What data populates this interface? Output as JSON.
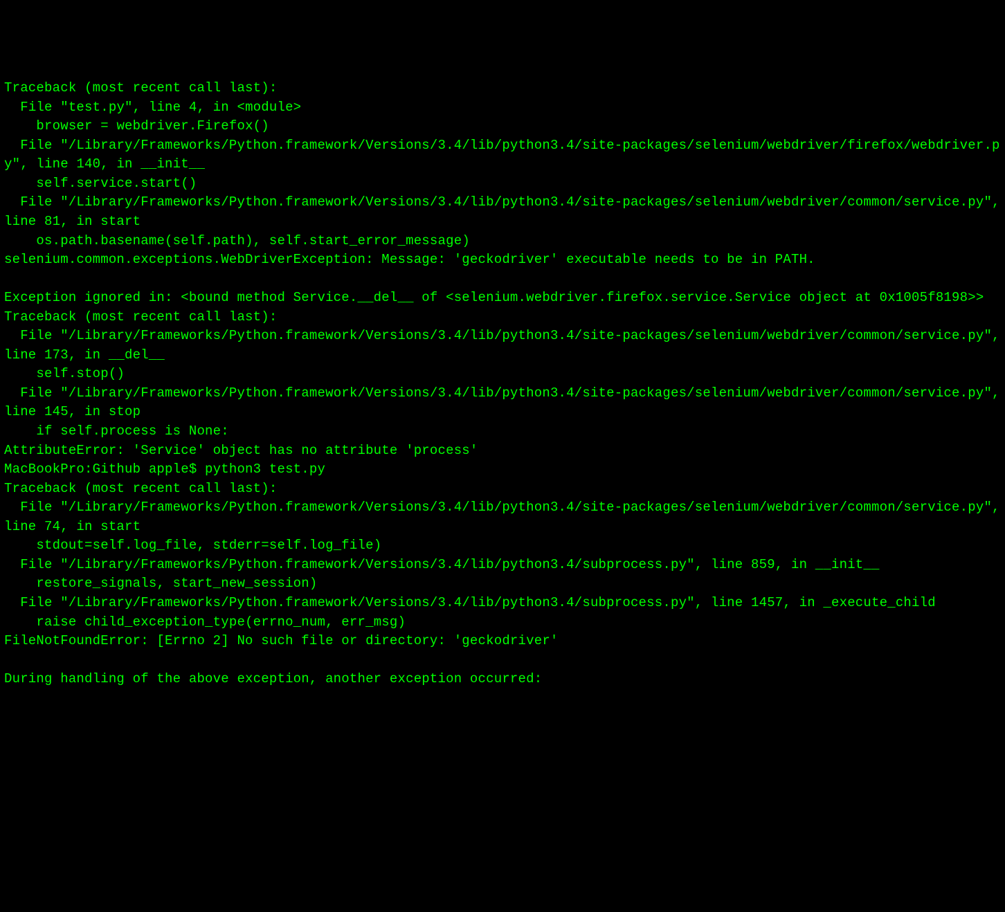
{
  "terminal": {
    "lines": [
      "Traceback (most recent call last):",
      "  File \"test.py\", line 4, in <module>",
      "    browser = webdriver.Firefox()",
      "  File \"/Library/Frameworks/Python.framework/Versions/3.4/lib/python3.4/site-packages/selenium/webdriver/firefox/webdriver.py\", line 140, in __init__",
      "    self.service.start()",
      "  File \"/Library/Frameworks/Python.framework/Versions/3.4/lib/python3.4/site-packages/selenium/webdriver/common/service.py\", line 81, in start",
      "    os.path.basename(self.path), self.start_error_message)",
      "selenium.common.exceptions.WebDriverException: Message: 'geckodriver' executable needs to be in PATH. ",
      "",
      "Exception ignored in: <bound method Service.__del__ of <selenium.webdriver.firefox.service.Service object at 0x1005f8198>>",
      "Traceback (most recent call last):",
      "  File \"/Library/Frameworks/Python.framework/Versions/3.4/lib/python3.4/site-packages/selenium/webdriver/common/service.py\", line 173, in __del__",
      "    self.stop()",
      "  File \"/Library/Frameworks/Python.framework/Versions/3.4/lib/python3.4/site-packages/selenium/webdriver/common/service.py\", line 145, in stop",
      "    if self.process is None:",
      "AttributeError: 'Service' object has no attribute 'process'",
      "MacBookPro:Github apple$ python3 test.py",
      "Traceback (most recent call last):",
      "  File \"/Library/Frameworks/Python.framework/Versions/3.4/lib/python3.4/site-packages/selenium/webdriver/common/service.py\", line 74, in start",
      "    stdout=self.log_file, stderr=self.log_file)",
      "  File \"/Library/Frameworks/Python.framework/Versions/3.4/lib/python3.4/subprocess.py\", line 859, in __init__",
      "    restore_signals, start_new_session)",
      "  File \"/Library/Frameworks/Python.framework/Versions/3.4/lib/python3.4/subprocess.py\", line 1457, in _execute_child",
      "    raise child_exception_type(errno_num, err_msg)",
      "FileNotFoundError: [Errno 2] No such file or directory: 'geckodriver'",
      "",
      "During handling of the above exception, another exception occurred:",
      ""
    ]
  }
}
